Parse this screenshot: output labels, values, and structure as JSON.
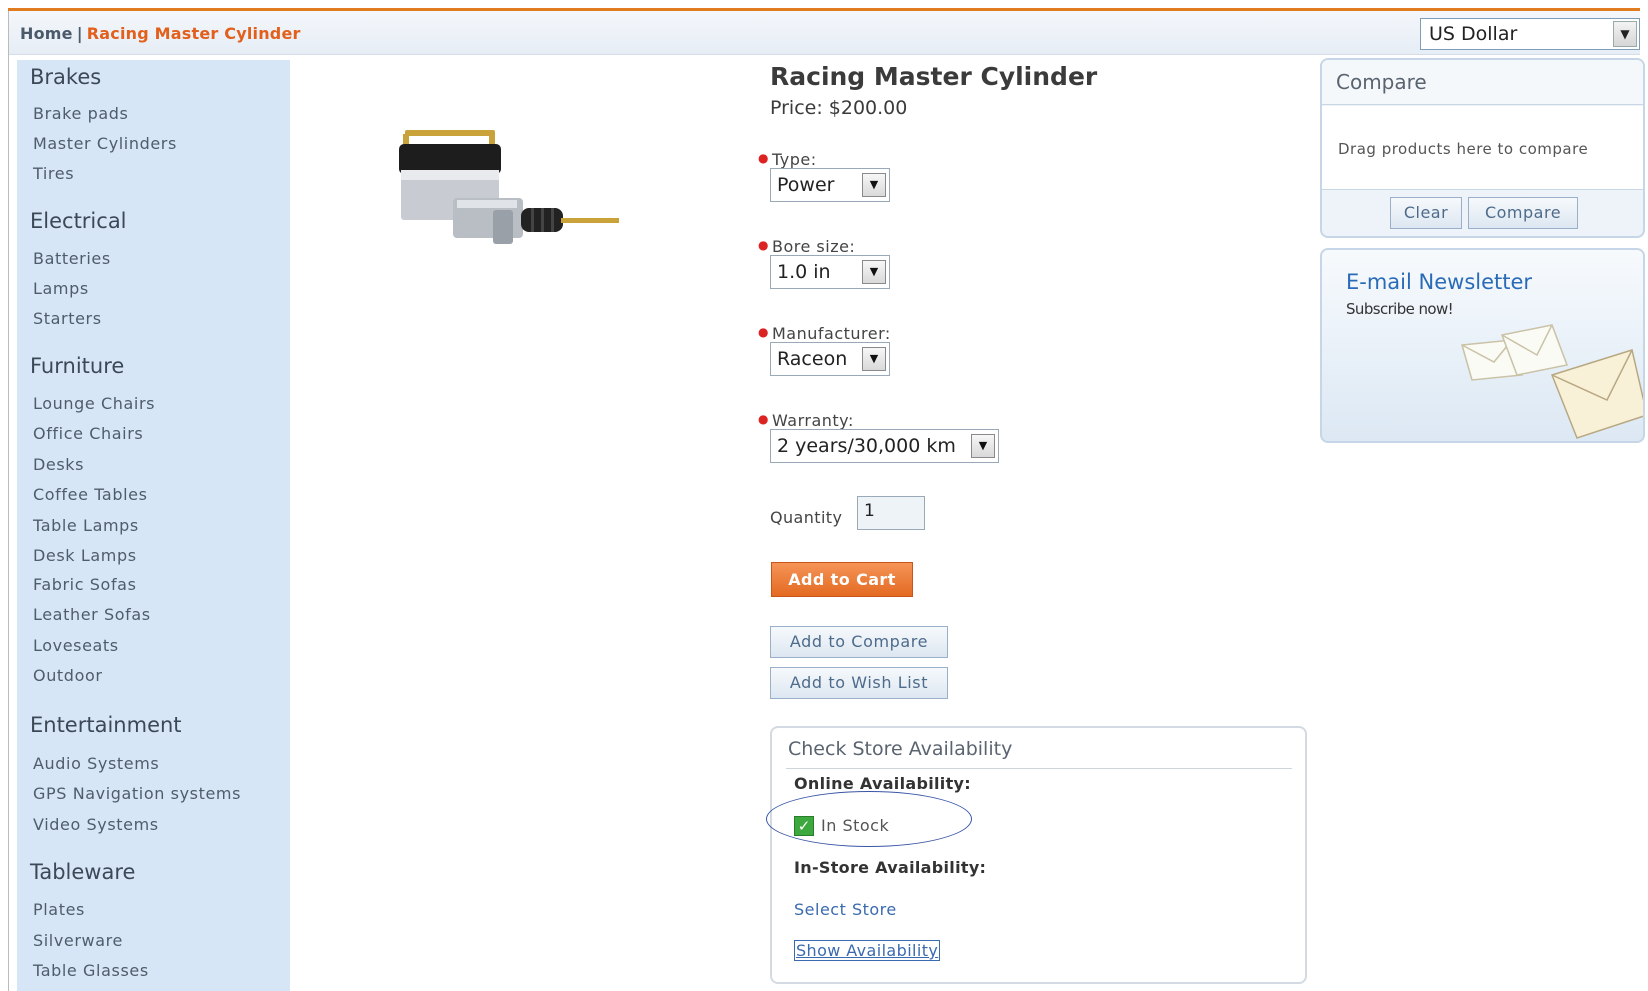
{
  "breadcrumb": {
    "home": "Home",
    "separator": "|",
    "current": "Racing Master Cylinder"
  },
  "currency": {
    "selected": "US Dollar"
  },
  "sidebar": {
    "categories": [
      {
        "heading": "Brakes",
        "items": [
          "Brake pads",
          "Master Cylinders",
          "Tires"
        ]
      },
      {
        "heading": "Electrical",
        "items": [
          "Batteries",
          "Lamps",
          "Starters"
        ]
      },
      {
        "heading": "Furniture",
        "items": [
          "Lounge Chairs",
          "Office Chairs",
          "Desks",
          "Coffee Tables",
          "Table Lamps",
          "Desk Lamps",
          "Fabric Sofas",
          "Leather Sofas",
          "Loveseats",
          "Outdoor"
        ]
      },
      {
        "heading": "Entertainment",
        "items": [
          "Audio Systems",
          "GPS Navigation systems",
          "Video Systems"
        ]
      },
      {
        "heading": "Tableware",
        "items": [
          "Plates",
          "Silverware",
          "Table Glasses"
        ]
      }
    ]
  },
  "product": {
    "title": "Racing Master Cylinder",
    "price": "Price: $200.00",
    "image_icon": "master-cylinder-image"
  },
  "options": {
    "type": {
      "label": "Type:",
      "value": "Power"
    },
    "bore": {
      "label": "Bore size:",
      "value": "1.0 in"
    },
    "manufacturer": {
      "label": "Manufacturer:",
      "value": "Raceon"
    },
    "warranty": {
      "label": "Warranty:",
      "value": "2 years/30,000 km"
    }
  },
  "quantity": {
    "label": "Quantity",
    "value": "1"
  },
  "buttons": {
    "add_to_cart": "Add to Cart",
    "add_to_compare": "Add to Compare",
    "add_to_wishlist": "Add to Wish List"
  },
  "availability": {
    "title": "Check Store Availability",
    "online_label": "Online Availability:",
    "online_status": "In Stock",
    "instore_label": "In-Store Availability:",
    "select_store": "Select Store",
    "show_availability": "Show Availability"
  },
  "compare": {
    "title": "Compare",
    "hint": "Drag products here to compare",
    "clear": "Clear",
    "compare": "Compare"
  },
  "newsletter": {
    "title": "E-mail Newsletter",
    "subtitle": "Subscribe now!"
  },
  "colors": {
    "accent_orange": "#e36a22",
    "sidebar_bg": "#d7e6f6",
    "link_blue": "#3a6ab0",
    "annotation_ellipse": "#3a56a6"
  }
}
